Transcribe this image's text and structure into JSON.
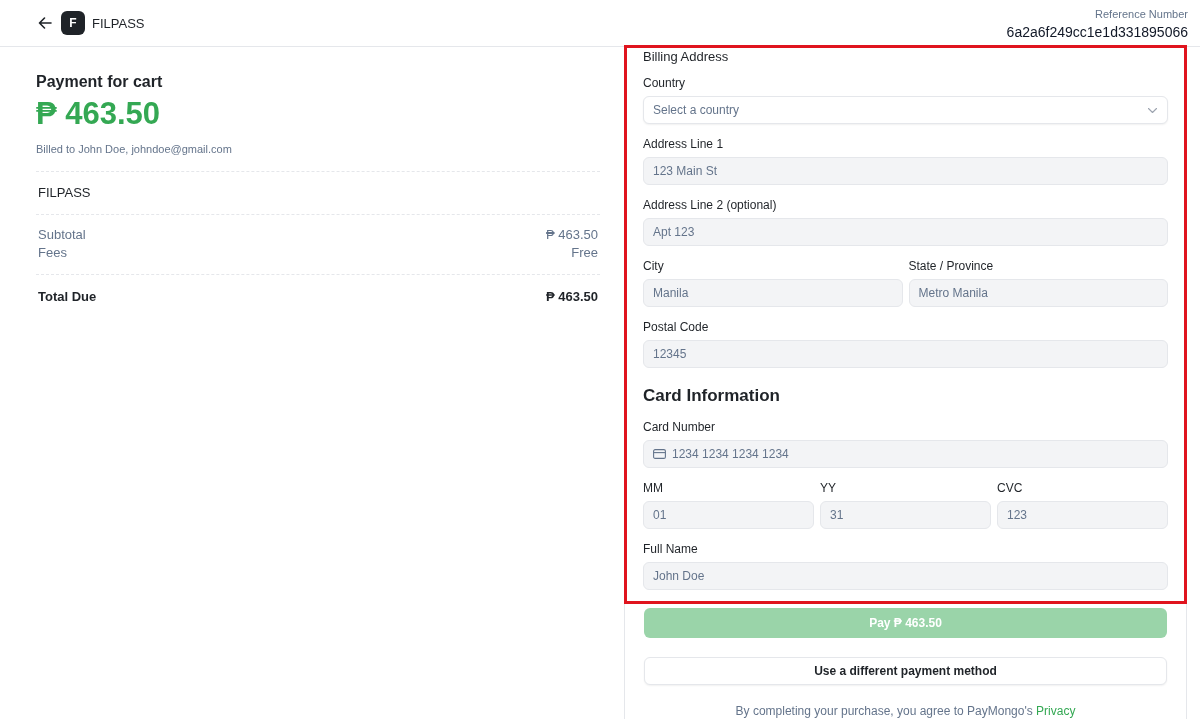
{
  "header": {
    "brand_initial": "F",
    "brand_name": "FILPASS",
    "reference_label": "Reference Number",
    "reference_number": "6a2a6f249cc1e1d331895066"
  },
  "summary": {
    "title": "Payment for cart",
    "amount": "₱ 463.50",
    "billed_to": "Billed to John Doe, johndoe@gmail.com",
    "merchant": "FILPASS",
    "lines": [
      {
        "label": "Subtotal",
        "value": "₱ 463.50"
      },
      {
        "label": "Fees",
        "value": "Free"
      }
    ],
    "total": {
      "label": "Total Due",
      "value": "₱ 463.50"
    }
  },
  "form": {
    "highlighted": true,
    "sections": [
      {
        "title": "Billing Address",
        "kind": "subheading",
        "rows": [
          {
            "fields": [
              {
                "label": "Country",
                "kind": "select",
                "placeholder": "Select a country"
              }
            ]
          },
          {
            "fields": [
              {
                "label": "Address Line 1",
                "kind": "text",
                "placeholder": "123 Main St"
              }
            ]
          },
          {
            "fields": [
              {
                "label": "Address Line 2 (optional)",
                "kind": "text",
                "placeholder": "Apt 123"
              }
            ]
          },
          {
            "fields": [
              {
                "label": "City",
                "kind": "text",
                "placeholder": "Manila"
              },
              {
                "label": "State / Province",
                "kind": "text",
                "placeholder": "Metro Manila"
              }
            ]
          },
          {
            "fields": [
              {
                "label": "Postal Code",
                "kind": "text",
                "placeholder": "12345"
              }
            ]
          }
        ]
      },
      {
        "title": "Card Information",
        "kind": "heading",
        "rows": [
          {
            "fields": [
              {
                "label": "Card Number",
                "kind": "card",
                "placeholder": "1234 1234 1234 1234"
              }
            ]
          },
          {
            "fields": [
              {
                "label": "MM",
                "kind": "text",
                "placeholder": "01"
              },
              {
                "label": "YY",
                "kind": "text",
                "placeholder": "31"
              },
              {
                "label": "CVC",
                "kind": "text",
                "placeholder": "123"
              }
            ]
          },
          {
            "fields": [
              {
                "label": "Full Name",
                "kind": "text",
                "placeholder": "John Doe"
              }
            ]
          }
        ]
      }
    ]
  },
  "actions": {
    "pay": {
      "label": "Pay ₱ 463.50",
      "disabled": true
    },
    "alternate": {
      "label": "Use a different payment method"
    }
  },
  "footer": {
    "text": "By completing your purchase, you agree to PayMongo's",
    "link": "Privacy"
  }
}
